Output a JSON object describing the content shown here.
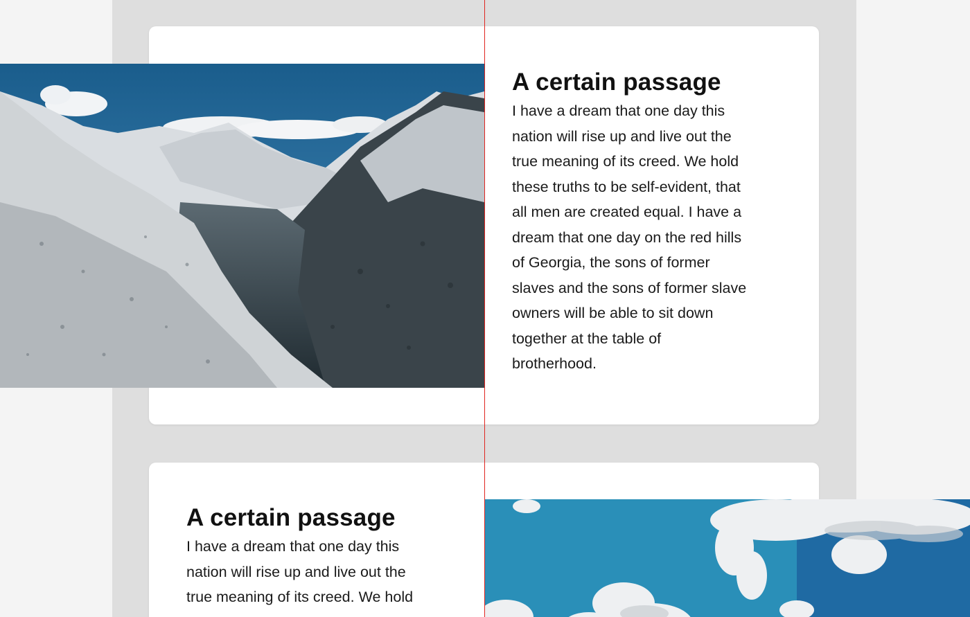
{
  "colors": {
    "page_background": "#f4f4f4",
    "container_background": "#dedede",
    "card_background": "#ffffff",
    "guide_line": "#e0241f",
    "text": "#111111"
  },
  "sections": [
    {
      "image_alt_icon": "mountain-landscape-image",
      "title": "A certain passage",
      "body": "I have a dream that one day this\nnation will rise up and live out the\ntrue meaning of its creed. We hold\nthese truths to be self-evident, that\nall men are created equal. I have a\ndream that one day on the red hills\nof Georgia, the sons of former\nslaves and the sons of former slave\nowners will be able to sit down\ntogether at the table of\nbrotherhood."
    },
    {
      "image_alt_icon": "sky-clouds-image",
      "title": "A certain passage",
      "body": "I have a dream that one day this\nnation will rise up and live out the\ntrue meaning of its creed. We hold"
    }
  ]
}
